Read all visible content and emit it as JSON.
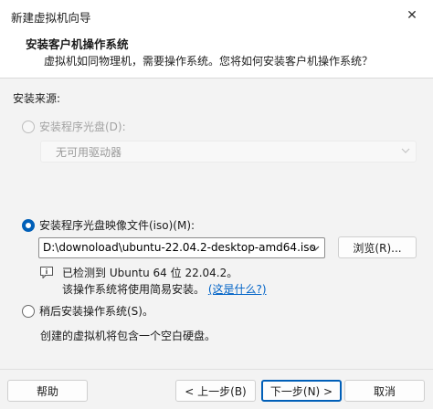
{
  "window": {
    "title": "新建虚拟机向导",
    "close_glyph": "✕"
  },
  "header": {
    "title": "安装客户机操作系统",
    "subtitle": "虚拟机如同物理机，需要操作系统。您将如何安装客户机操作系统？"
  },
  "source": {
    "label": "安装来源:",
    "options": {
      "disc": {
        "label": "安装程序光盘(D):",
        "state": "disabled",
        "drive_value": "无可用驱动器"
      },
      "iso": {
        "label": "安装程序光盘映像文件(iso)(M):",
        "state": "checked",
        "path_value": "D:\\downoload\\ubuntu-22.04.2-desktop-amd64.iso",
        "browse_label": "浏览(R)...",
        "detected_prefix": "已检测到 Ubuntu 64 位 22.04.2。",
        "note_text": "该操作系统将使用简易安装。",
        "note_link": "(这是什么?)"
      },
      "later": {
        "label": "稍后安装操作系统(S)。",
        "state": "unchecked",
        "description": "创建的虚拟机将包含一个空白硬盘。"
      }
    }
  },
  "footer": {
    "help_label": "帮助",
    "back_label": "< 上一步(B)",
    "next_label": "下一步(N) >",
    "cancel_label": "取消"
  },
  "colors": {
    "accent": "#005fb8",
    "link": "#0063c7",
    "background": "#f3f3f3"
  }
}
